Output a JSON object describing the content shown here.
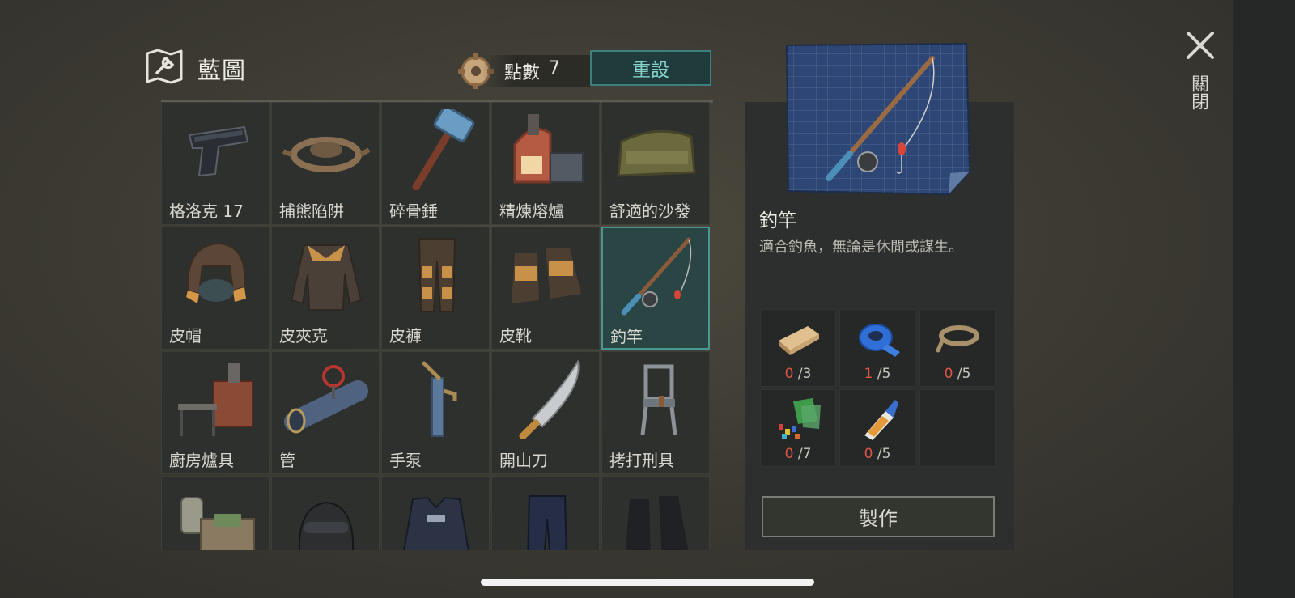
{
  "header": {
    "title": "藍圖",
    "points_label": "點數",
    "points_value": "7",
    "reset_label": "重設"
  },
  "close": {
    "label": "關閉"
  },
  "grid": {
    "items": [
      {
        "label": "格洛克 17",
        "icon": "pistol-icon"
      },
      {
        "label": "捕熊陷阱",
        "icon": "bear-trap-icon"
      },
      {
        "label": "碎骨錘",
        "icon": "sledgehammer-icon"
      },
      {
        "label": "精煉熔爐",
        "icon": "furnace-icon"
      },
      {
        "label": "舒適的沙發",
        "icon": "sofa-icon"
      },
      {
        "label": "皮帽",
        "icon": "leather-hat-icon"
      },
      {
        "label": "皮夾克",
        "icon": "leather-jacket-icon"
      },
      {
        "label": "皮褲",
        "icon": "leather-pants-icon"
      },
      {
        "label": "皮靴",
        "icon": "leather-boots-icon"
      },
      {
        "label": "釣竿",
        "icon": "fishing-rod-icon",
        "selected": true
      },
      {
        "label": "廚房爐具",
        "icon": "kitchen-stove-icon"
      },
      {
        "label": "管",
        "icon": "pipe-icon"
      },
      {
        "label": "手泵",
        "icon": "hand-pump-icon"
      },
      {
        "label": "開山刀",
        "icon": "machete-icon"
      },
      {
        "label": "拷打刑具",
        "icon": "torture-chair-icon"
      },
      {
        "label": "",
        "icon": "workbench-icon"
      },
      {
        "label": "",
        "icon": "helmet-icon"
      },
      {
        "label": "",
        "icon": "police-vest-icon"
      },
      {
        "label": "",
        "icon": "police-pants-icon"
      },
      {
        "label": "",
        "icon": "police-boots-icon"
      }
    ]
  },
  "detail": {
    "name": "釣竿",
    "description": "適合釣魚，無論是休閒或謀生。",
    "image": "fishing-rod-blueprint-icon",
    "materials": [
      {
        "icon": "wood-plank-icon",
        "have": "0",
        "need": "/3"
      },
      {
        "icon": "duct-tape-icon",
        "have": "1",
        "need": "/5"
      },
      {
        "icon": "rope-icon",
        "have": "0",
        "need": "/5"
      },
      {
        "icon": "plastic-scraps-icon",
        "have": "0",
        "need": "/7"
      },
      {
        "icon": "glue-icon",
        "have": "0",
        "need": "/5"
      },
      {
        "icon": "",
        "have": "",
        "need": ""
      }
    ],
    "craft_label": "製作"
  },
  "colors": {
    "accent": "#4a9692",
    "missing": "#e05545",
    "reset_text": "#86d3cd"
  }
}
